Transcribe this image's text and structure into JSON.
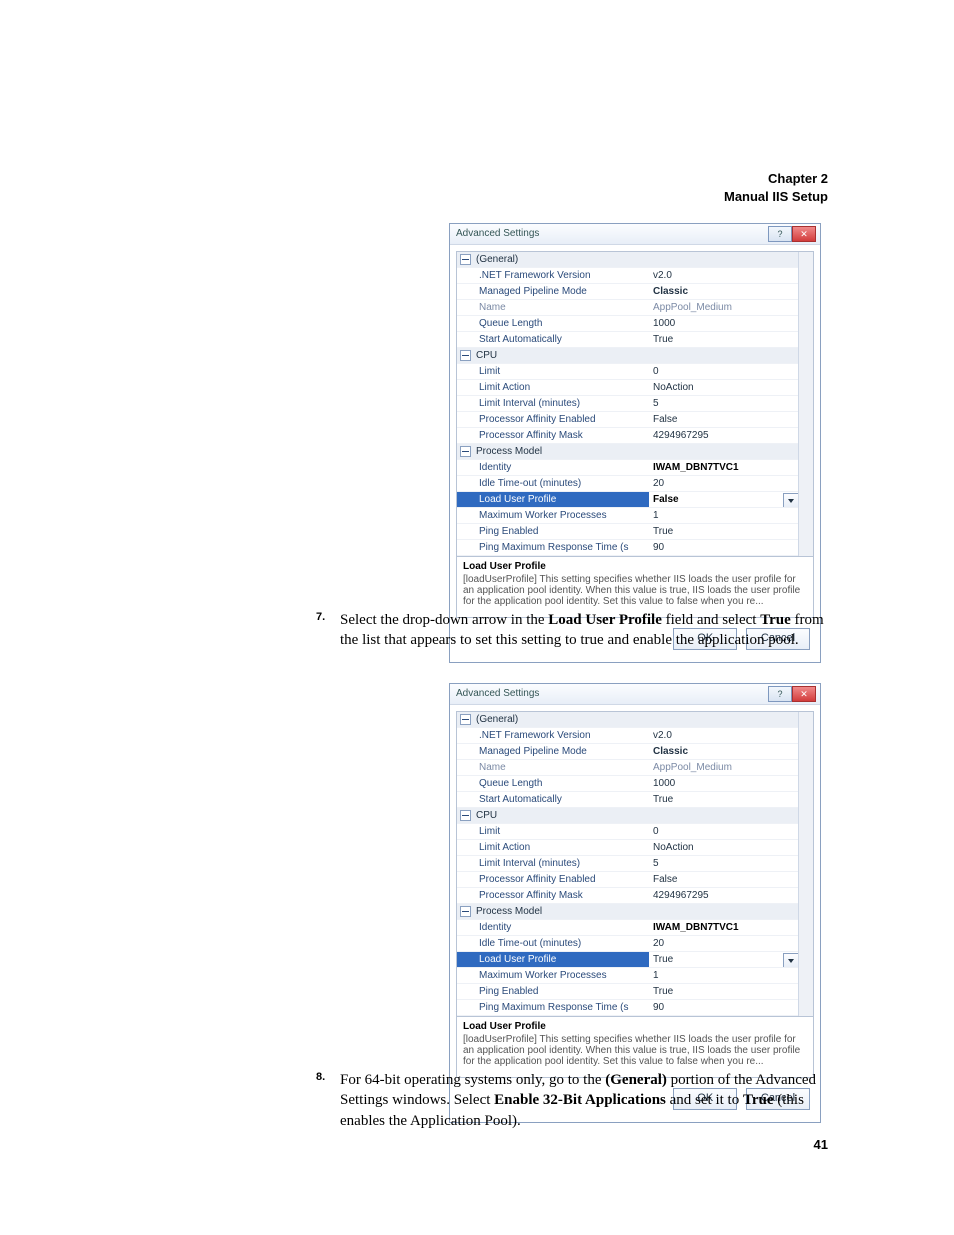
{
  "header": {
    "chapter": "Chapter 2",
    "title": "Manual IIS Setup"
  },
  "page_number": "41",
  "step7": {
    "num": "7.",
    "pre": "Select the drop-down arrow in the ",
    "b1": "Load User Profile",
    "mid": " field and select ",
    "b2": "True",
    "post": " from the list that appears to set this setting to true and enable the application pool."
  },
  "step8": {
    "num": "8.",
    "pre": "For 64-bit operating systems only, go to the ",
    "b1": "(General)",
    "mid": " portion of the Advanced Settings windows. Select ",
    "b2": "Enable 32-Bit Applications",
    "mid2": " and set it to ",
    "b3": "True",
    "post": " (this enables the Application Pool)."
  },
  "dlg": {
    "title": "Advanced Settings",
    "ok": "OK",
    "cancel": "Cancel",
    "desc_title": "Load User Profile",
    "desc_body": "[loadUserProfile] This setting specifies whether IIS loads the user profile for an application pool identity. When this value is true, IIS loads the user profile for the application pool identity. Set this value to false when you re...",
    "cats": {
      "general": "(General)",
      "cpu": "CPU",
      "pm": "Process Model"
    },
    "rows": {
      "netfx": {
        "k": ".NET Framework Version",
        "v": "v2.0"
      },
      "pipe": {
        "k": "Managed Pipeline Mode",
        "v": "Classic"
      },
      "name": {
        "k": "Name",
        "v": "AppPool_Medium"
      },
      "queue": {
        "k": "Queue Length",
        "v": "1000"
      },
      "start": {
        "k": "Start Automatically",
        "v": "True"
      },
      "limit": {
        "k": "Limit",
        "v": "0"
      },
      "laction": {
        "k": "Limit Action",
        "v": "NoAction"
      },
      "lint": {
        "k": "Limit Interval (minutes)",
        "v": "5"
      },
      "pae": {
        "k": "Processor Affinity Enabled",
        "v": "False"
      },
      "pam": {
        "k": "Processor Affinity Mask",
        "v": "4294967295"
      },
      "identity": {
        "k": "Identity",
        "v": "IWAM_DBN7TVC1"
      },
      "idle": {
        "k": "Idle Time-out (minutes)",
        "v": "20"
      },
      "lup": {
        "k": "Load User Profile"
      },
      "mwp": {
        "k": "Maximum Worker Processes",
        "v": "1"
      },
      "ping": {
        "k": "Ping Enabled",
        "v": "True"
      },
      "pmax": {
        "k": "Ping Maximum Response Time (s",
        "v": "90"
      }
    },
    "lup_v1": "False",
    "lup_v2": "True"
  }
}
